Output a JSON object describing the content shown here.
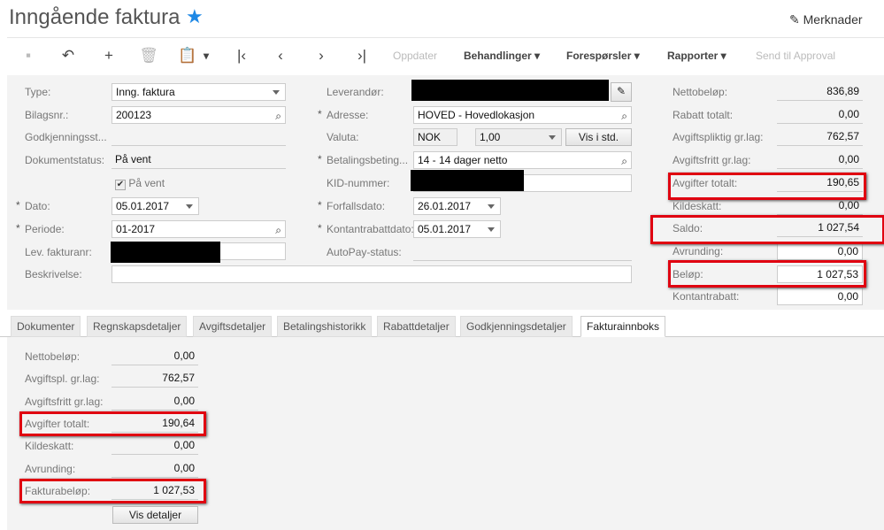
{
  "header": {
    "title": "Inngående faktura",
    "notes": "Merknader"
  },
  "toolbar": {
    "refresh": "Oppdater",
    "actions": "Behandlinger",
    "inquiries": "Forespørsler",
    "reports": "Rapporter",
    "send": "Send til Approval"
  },
  "form": {
    "type": {
      "label": "Type:",
      "value": "Inng. faktura"
    },
    "doc_no": {
      "label": "Bilagsnr.:",
      "value": "200123"
    },
    "approval": {
      "label": "Godkjenningsst...",
      "value": ""
    },
    "doc_status": {
      "label": "Dokumentstatus:",
      "value": "På vent"
    },
    "hold": {
      "label": "På vent",
      "checked": true
    },
    "date": {
      "label": "Dato:",
      "value": "05.01.2017"
    },
    "period": {
      "label": "Periode:",
      "value": "01-2017"
    },
    "vendor_ref": {
      "label": "Lev. fakturanr:"
    },
    "description": {
      "label": "Beskrivelse:",
      "value": ""
    },
    "vendor": {
      "label": "Leverandør:"
    },
    "address": {
      "label": "Adresse:",
      "value": "HOVED - Hovedlokasjon"
    },
    "currency": {
      "label": "Valuta:",
      "value": "NOK",
      "rate": "1,00",
      "button": "Vis i std."
    },
    "terms": {
      "label": "Betalingsbeting...",
      "value": "14 - 14 dager netto"
    },
    "kid": {
      "label": "KID-nummer:"
    },
    "due_date": {
      "label": "Forfallsdato:",
      "value": "26.01.2017"
    },
    "discount_date": {
      "label": "Kontantrabattdato:",
      "value": "05.01.2017"
    },
    "autopay": {
      "label": "AutoPay-status:",
      "value": ""
    },
    "required_mark": "*"
  },
  "totals": [
    {
      "label": "Nettobeløp:",
      "value": "836,89"
    },
    {
      "label": "Rabatt totalt:",
      "value": "0,00"
    },
    {
      "label": "Avgiftspliktig gr.lag:",
      "value": "762,57"
    },
    {
      "label": "Avgiftsfritt gr.lag:",
      "value": "0,00"
    },
    {
      "label": "Avgifter totalt:",
      "value": "190,65"
    },
    {
      "label": "Kildeskatt:",
      "value": "0,00"
    },
    {
      "label": "Saldo:",
      "value": "1 027,54"
    },
    {
      "label": "Avrunding:",
      "value": "0,00"
    },
    {
      "label": "Beløp:",
      "value": "1 027,53"
    },
    {
      "label": "Kontantrabatt:",
      "value": "0,00"
    }
  ],
  "tabs": [
    "Dokumenter",
    "Regnskapsdetaljer",
    "Avgiftsdetaljer",
    "Betalingshistorikk",
    "Rabattdetaljer",
    "Godkjenningsdetaljer",
    "Fakturainnboks"
  ],
  "inbox": {
    "rows": [
      {
        "label": "Nettobeløp:",
        "value": "0,00"
      },
      {
        "label": "Avgiftspl. gr.lag:",
        "value": "762,57"
      },
      {
        "label": "Avgiftsfritt gr.lag:",
        "value": "0,00"
      },
      {
        "label": "Avgifter totalt:",
        "value": "190,64"
      },
      {
        "label": "Kildeskatt:",
        "value": "0,00"
      },
      {
        "label": "Avrunding:",
        "value": "0,00"
      },
      {
        "label": "Fakturabeløp:",
        "value": "1 027,53"
      }
    ],
    "details_button": "Vis detaljer"
  },
  "colors": {
    "highlight": "#e00010",
    "star": "#1e88e5"
  }
}
